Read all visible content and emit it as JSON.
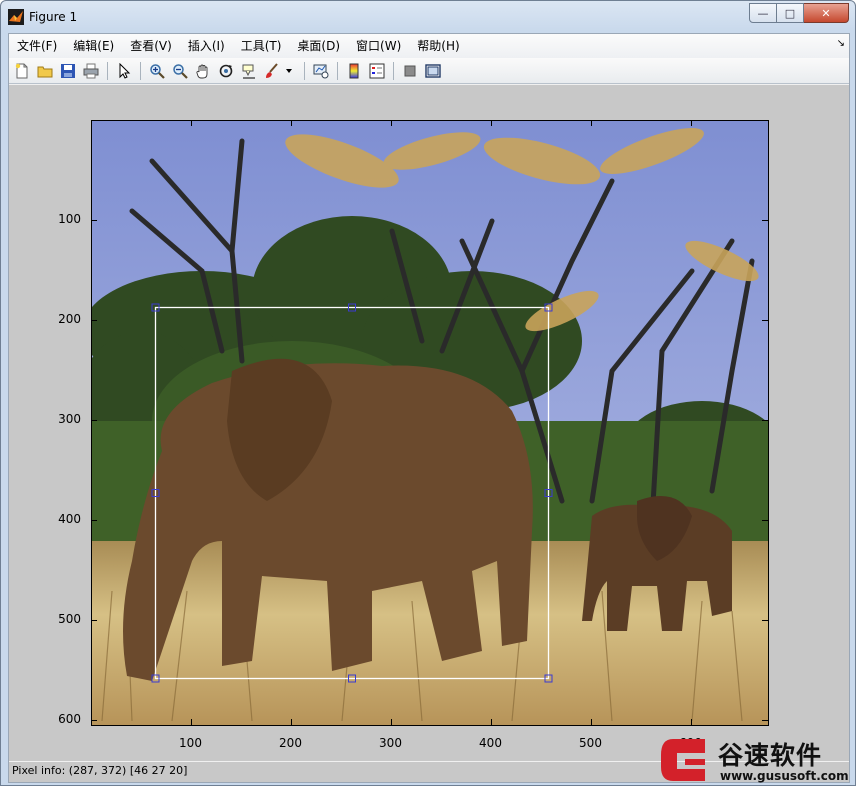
{
  "window": {
    "title": "Figure 1"
  },
  "menu": [
    "文件(F)",
    "编辑(E)",
    "查看(V)",
    "插入(I)",
    "工具(T)",
    "桌面(D)",
    "窗口(W)",
    "帮助(H)"
  ],
  "toolbar": [
    "new-figure-icon",
    "open-icon",
    "save-icon",
    "print-icon",
    "|",
    "pointer-icon",
    "|",
    "zoom-in-icon",
    "zoom-out-icon",
    "pan-hand-icon",
    "rotate-3d-icon",
    "data-cursor-icon",
    "brush-icon",
    "brush-dropdown-icon",
    "|",
    "link-plot-icon",
    "|",
    "colorbar-icon",
    "legend-icon",
    "|",
    "hide-plot-tools-icon",
    "show-plot-tools-icon"
  ],
  "axes": {
    "yticks": [
      "100",
      "200",
      "300",
      "400",
      "500",
      "600"
    ],
    "xticks": [
      "100",
      "200",
      "300",
      "400",
      "500",
      "600"
    ],
    "xlim": [
      0.5,
      676.5
    ],
    "ylim": [
      0.5,
      604.5
    ],
    "roi_rect": {
      "x": 64,
      "y": 187,
      "width": 393,
      "height": 371
    }
  },
  "status": {
    "pixel_info": "Pixel info: (287, 372)  [46 27 20]"
  },
  "watermark": {
    "brand": "谷速软件",
    "url": "www.gususoft.com"
  }
}
